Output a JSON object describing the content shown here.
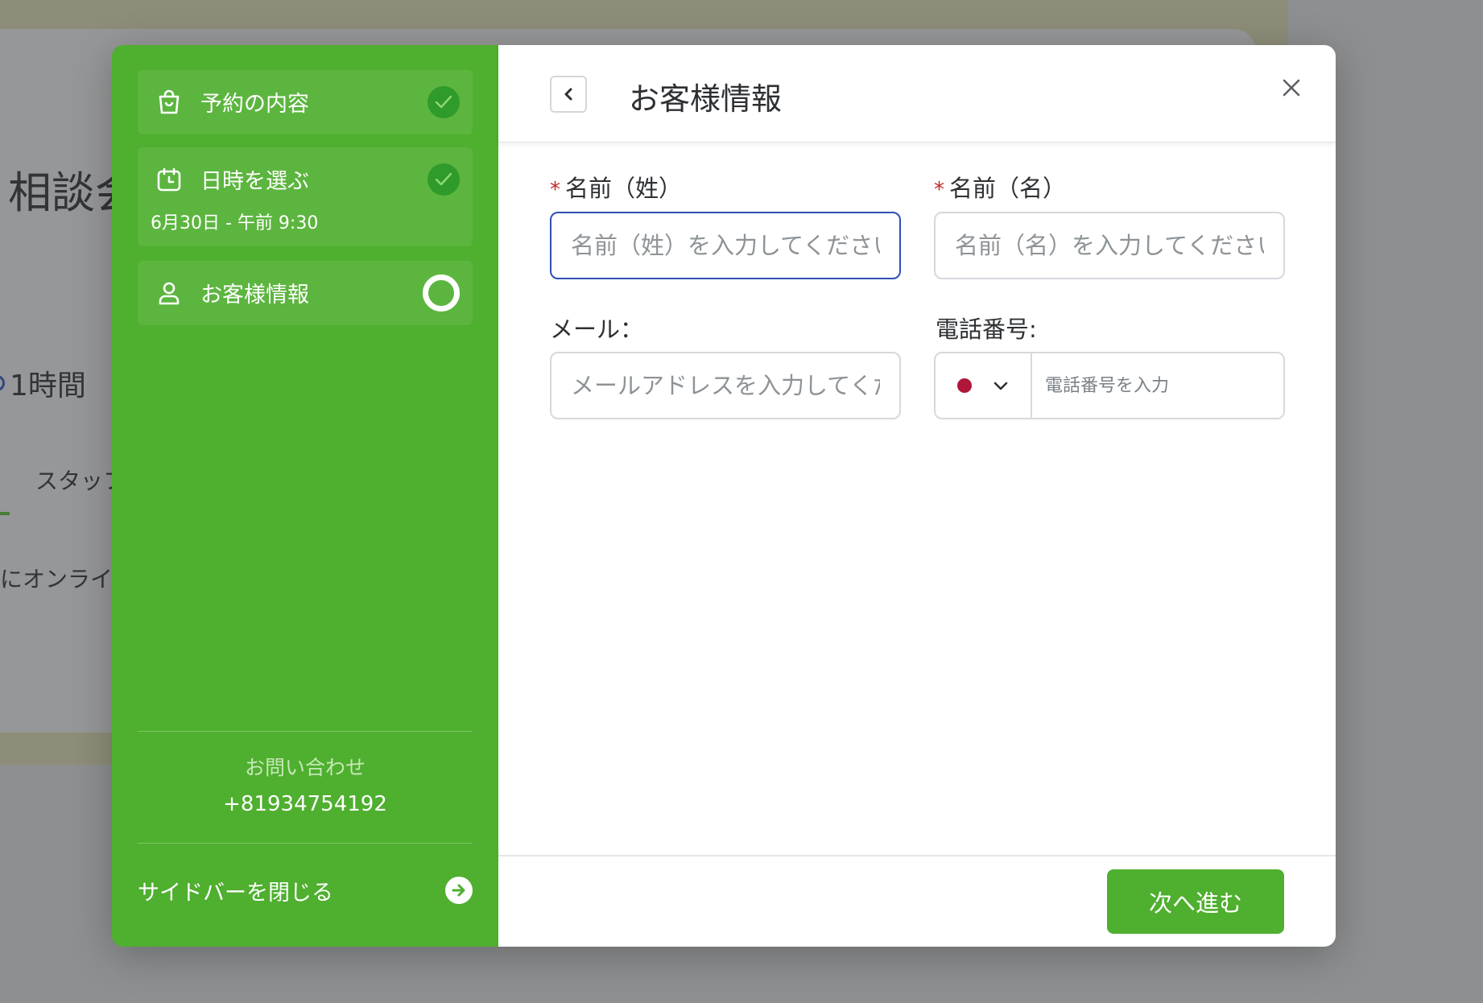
{
  "background": {
    "title_fragment": "相談会",
    "duration": "1時間",
    "tab_fragment": "スタッフ",
    "description_fragment": "にオンライ"
  },
  "sidebar": {
    "steps": [
      {
        "label": "予約の内容",
        "status": "complete",
        "icon": "shopping-bag-icon"
      },
      {
        "label": "日時を選ぶ",
        "detail": "6月30日 - 午前 9:30",
        "status": "complete",
        "icon": "calendar-icon"
      },
      {
        "label": "お客様情報",
        "status": "current",
        "icon": "user-icon"
      }
    ],
    "contact_label": "お問い合わせ",
    "contact_phone": "+81934754192",
    "close_label": "サイドバーを閉じる"
  },
  "header": {
    "title": "お客様情報"
  },
  "form": {
    "last_name": {
      "label": "名前（姓）",
      "required": true,
      "placeholder": "名前（姓）を入力してください",
      "value": ""
    },
    "first_name": {
      "label": "名前（名）",
      "required": true,
      "placeholder": "名前（名）を入力してください",
      "value": ""
    },
    "email": {
      "label": "メール：",
      "placeholder": "メールアドレスを入力してください",
      "value": ""
    },
    "phone": {
      "label": "電話番号:",
      "country": "JP",
      "placeholder": "電話番号を入力",
      "value": ""
    },
    "required_mark": "*"
  },
  "footer": {
    "next_label": "次へ進む"
  },
  "colors": {
    "accent": "#4faf2f",
    "check_fill": "#2e9b2a",
    "focus_border": "#2f4fb4",
    "required": "#c02a2a"
  }
}
